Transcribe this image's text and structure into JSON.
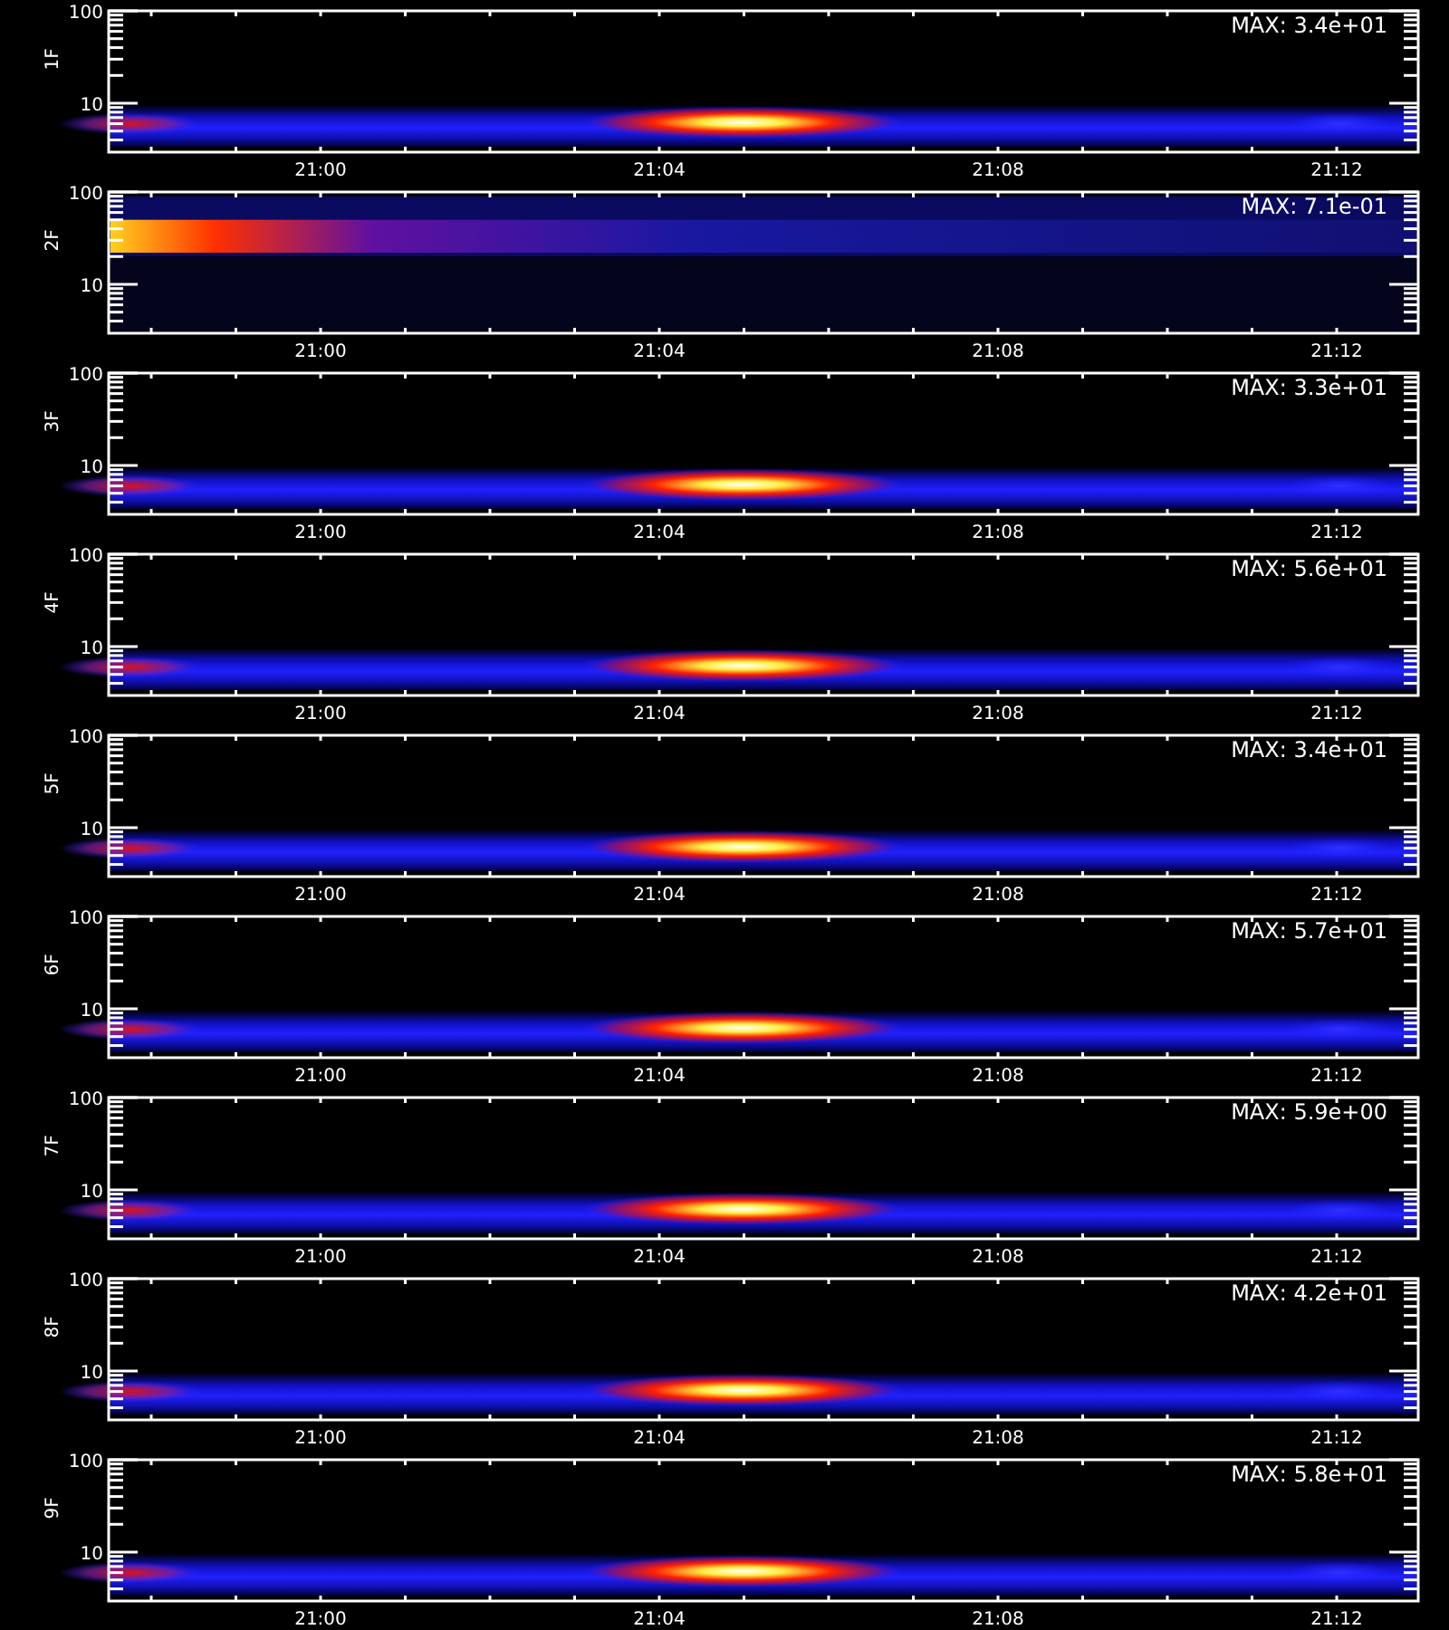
{
  "panels": [
    {
      "label": "1F",
      "max": "MAX: 3.4e+01",
      "kind": "low-band",
      "y_ticks": [
        "100",
        "10"
      ],
      "x_ticks": [
        "21:00",
        "21:04",
        "21:08",
        "21:12"
      ]
    },
    {
      "label": "2F",
      "max": "MAX: 7.1e-01",
      "kind": "high-band",
      "y_ticks": [
        "100",
        "10"
      ],
      "x_ticks": [
        "21:00",
        "21:04",
        "21:08",
        "21:12"
      ]
    },
    {
      "label": "3F",
      "max": "MAX: 3.3e+01",
      "kind": "low-band",
      "y_ticks": [
        "100",
        "10"
      ],
      "x_ticks": [
        "21:00",
        "21:04",
        "21:08",
        "21:12"
      ]
    },
    {
      "label": "4F",
      "max": "MAX: 5.6e+01",
      "kind": "low-band",
      "y_ticks": [
        "100",
        "10"
      ],
      "x_ticks": [
        "21:00",
        "21:04",
        "21:08",
        "21:12"
      ]
    },
    {
      "label": "5F",
      "max": "MAX: 3.4e+01",
      "kind": "low-band",
      "y_ticks": [
        "100",
        "10"
      ],
      "x_ticks": [
        "21:00",
        "21:04",
        "21:08",
        "21:12"
      ]
    },
    {
      "label": "6F",
      "max": "MAX: 5.7e+01",
      "kind": "low-band",
      "y_ticks": [
        "100",
        "10"
      ],
      "x_ticks": [
        "21:00",
        "21:04",
        "21:08",
        "21:12"
      ]
    },
    {
      "label": "7F",
      "max": "MAX: 5.9e+00",
      "kind": "low-band",
      "y_ticks": [
        "100",
        "10"
      ],
      "x_ticks": [
        "21:00",
        "21:04",
        "21:08",
        "21:12"
      ]
    },
    {
      "label": "8F",
      "max": "MAX: 4.2e+01",
      "kind": "low-band",
      "y_ticks": [
        "100",
        "10"
      ],
      "x_ticks": [
        "21:00",
        "21:04",
        "21:08",
        "21:12"
      ]
    },
    {
      "label": "9F",
      "max": "MAX: 5.8e+01",
      "kind": "low-band",
      "y_ticks": [
        "100",
        "10"
      ],
      "x_ticks": [
        "21:00",
        "21:04",
        "21:08",
        "21:12"
      ]
    }
  ]
}
